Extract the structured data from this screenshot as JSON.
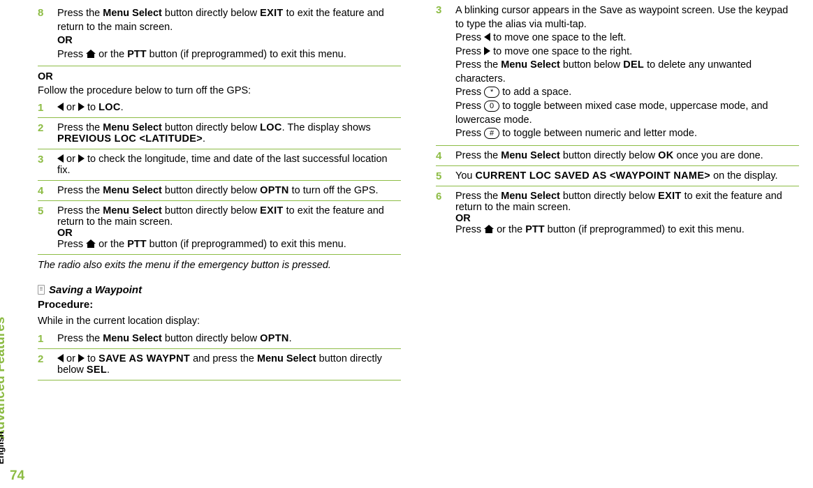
{
  "sidebar": {
    "label": "Advanced Features",
    "page": "74",
    "lang": "English"
  },
  "left": {
    "s8a": "Press the ",
    "s8b": "Menu Select",
    "s8c": " button directly below ",
    "s8d": "EXIT",
    "s8e": " to exit the feature and return to the main screen.",
    "s8or": "OR",
    "s8f": "Press ",
    "s8g": " or the ",
    "s8h": "PTT",
    "s8i": " button (if preprogrammed) to exit this menu.",
    "orlabel": "OR",
    "intro": "Follow the procedure below to turn off the GPS:",
    "l1a": " or ",
    "l1b": " to ",
    "l1c": "LOC",
    "l1d": ".",
    "l2a": "Press the ",
    "l2b": "Menu Select",
    "l2c": " button directly below ",
    "l2d": "LOC",
    "l2e": ". The display shows ",
    "l2f": "PREVIOUS LOC <LATITUDE>",
    "l2g": ".",
    "l3a": " or ",
    "l3b": " to check the longitude, time and date of the last successful location fix.",
    "l4a": "Press the ",
    "l4b": "Menu Select",
    "l4c": " button directly below ",
    "l4d": "OPTN",
    "l4e": " to turn off the GPS.",
    "l5a": "Press the ",
    "l5b": "Menu Select",
    "l5c": " button directly below ",
    "l5d": "EXIT",
    "l5e": " to exit the feature and return to the main screen.",
    "l5or": "OR",
    "l5f": "Press ",
    "l5g": " or the ",
    "l5h": "PTT",
    "l5i": " button (if preprogrammed) to exit this menu.",
    "note": "The radio also exits the menu if the emergency button is pressed.",
    "heading": "Saving a Waypoint"
  },
  "right": {
    "proc": "Procedure:",
    "intro": "While in the current location display:",
    "r1a": "Press the ",
    "r1b": "Menu Select",
    "r1c": " button directly below ",
    "r1d": "OPTN",
    "r1e": ".",
    "r2a": " or ",
    "r2b": " to ",
    "r2c": "SAVE AS WAYPNT",
    "r2d": " and press the ",
    "r2e": "Menu Select",
    "r2f": " button directly below ",
    "r2g": "SEL",
    "r2h": ".",
    "r3a": "A blinking cursor appears in the Save as waypoint screen. Use the keypad to type the alias via multi-tap.",
    "r3b": "Press ",
    "r3c": " to move one space to the left.",
    "r3d": "Press ",
    "r3e": " to move one space to the right.",
    "r3f": "Press the ",
    "r3g": "Menu Select",
    "r3h": " button below ",
    "r3i": "DEL",
    "r3j": " to delete any unwanted characters.",
    "r3k": "Press ",
    "r3l": " to add a space.",
    "r3m": "Press ",
    "r3n": " to toggle between mixed case mode, uppercase mode, and lowercase mode.",
    "r3o": "Press ",
    "r3p": " to toggle between numeric and letter mode.",
    "key_star": "*",
    "key_zero": "0",
    "key_hash": "#",
    "r4a": "Press the ",
    "r4b": "Menu Select",
    "r4c": " button directly below ",
    "r4d": "OK",
    "r4e": " once you are done.",
    "r5a": "You ",
    "r5b": "CURRENT LOC SAVED AS <WAYPOINT NAME>",
    "r5c": " on the display.",
    "r6a": "Press the ",
    "r6b": "Menu Select",
    "r6c": " button directly below ",
    "r6d": "EXIT",
    "r6e": " to exit the feature and return to the main screen.",
    "r6or": "OR",
    "r6f": "Press ",
    "r6g": " or the ",
    "r6h": "PTT",
    "r6i": " button (if preprogrammed) to exit this menu."
  },
  "nums": {
    "n1": "1",
    "n2": "2",
    "n3": "3",
    "n4": "4",
    "n5": "5",
    "n6": "6",
    "n8": "8"
  }
}
